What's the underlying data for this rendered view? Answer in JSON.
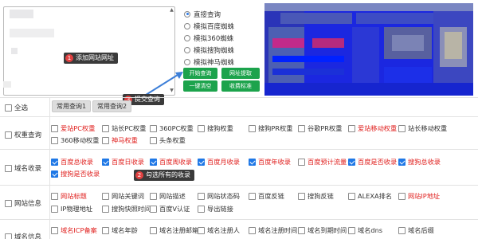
{
  "form": {
    "url_textarea_placeholder": "",
    "query_modes": [
      {
        "label": "直接查询",
        "selected": true
      },
      {
        "label": "模拟百度蜘蛛",
        "selected": false
      },
      {
        "label": "模拟360蜘蛛",
        "selected": false
      },
      {
        "label": "模拟搜狗蜘蛛",
        "selected": false
      },
      {
        "label": "模拟神马蜘蛛",
        "selected": false
      }
    ],
    "buttons": {
      "start_query": "开始查询",
      "extract_urls": "网址提取",
      "clear_all": "一键清空",
      "bookmark": "收费标准"
    }
  },
  "callouts": {
    "add_url": {
      "num": "1",
      "text": "添加网站网址"
    },
    "all_collect": {
      "num": "2",
      "text": "勾选所有的收录"
    },
    "submit": {
      "num": "3",
      "text": "提交查询"
    }
  },
  "colors": {
    "green": "#1ca34c",
    "red_text": "#e0211f",
    "checkbox_blue": "#1f78e6",
    "callout_bg": "#3a3a3a",
    "callout_badge": "#e14141",
    "arrow": "#3d7fd8"
  },
  "select_all": {
    "label": "全选",
    "presets": [
      "常用查询1",
      "常用查询2"
    ]
  },
  "sections": [
    {
      "label": "权重查询",
      "options": [
        {
          "label": "爱站PC权重",
          "checked": false,
          "red": true
        },
        {
          "label": "站长PC权重",
          "checked": false,
          "red": false
        },
        {
          "label": "360PC权重",
          "checked": false,
          "red": false
        },
        {
          "label": "搜狗权重",
          "checked": false,
          "red": false
        },
        {
          "label": "搜狗PR权重",
          "checked": false,
          "red": false
        },
        {
          "label": "谷歌PR权重",
          "checked": false,
          "red": false
        },
        {
          "label": "爱站移动权重",
          "checked": false,
          "red": true
        },
        {
          "label": "站长移动权重",
          "checked": false,
          "red": false
        },
        {
          "label": "360移动权重",
          "checked": false,
          "red": false
        },
        {
          "label": "神马权重",
          "checked": false,
          "red": true
        },
        {
          "label": "头条权重",
          "checked": false,
          "red": false
        }
      ]
    },
    {
      "label": "域名收录",
      "options": [
        {
          "label": "百度总收录",
          "checked": true,
          "red": true
        },
        {
          "label": "百度日收录",
          "checked": true,
          "red": true
        },
        {
          "label": "百度周收录",
          "checked": true,
          "red": true
        },
        {
          "label": "百度月收录",
          "checked": true,
          "red": true
        },
        {
          "label": "百度年收录",
          "checked": true,
          "red": true
        },
        {
          "label": "百度预计流量",
          "checked": false,
          "red": true
        },
        {
          "label": "百度是否收录",
          "checked": true,
          "red": true
        },
        {
          "label": "搜狗总收录",
          "checked": true,
          "red": true
        },
        {
          "label": "搜狗是否收录",
          "checked": true,
          "red": true
        }
      ]
    },
    {
      "label": "网站信息",
      "options": [
        {
          "label": "网站标题",
          "checked": false,
          "red": true
        },
        {
          "label": "网站关键词",
          "checked": false,
          "red": false
        },
        {
          "label": "网站描述",
          "checked": false,
          "red": false
        },
        {
          "label": "网站状态码",
          "checked": false,
          "red": false
        },
        {
          "label": "百度反链",
          "checked": false,
          "red": false
        },
        {
          "label": "搜狗反链",
          "checked": false,
          "red": false
        },
        {
          "label": "ALEXA排名",
          "checked": false,
          "red": false
        },
        {
          "label": "网站IP地址",
          "checked": false,
          "red": true
        },
        {
          "label": "IP物理地址",
          "checked": false,
          "red": false
        },
        {
          "label": "搜狗快照时间",
          "checked": false,
          "red": false
        },
        {
          "label": "百度V认证",
          "checked": false,
          "red": false
        },
        {
          "label": "导出链接",
          "checked": false,
          "red": false
        }
      ]
    },
    {
      "label": "域名信息",
      "options": [
        {
          "label": "域名ICP备案",
          "checked": false,
          "red": true
        },
        {
          "label": "域名年龄",
          "checked": false,
          "red": false
        },
        {
          "label": "域名注册邮箱",
          "checked": false,
          "red": false
        },
        {
          "label": "域名注册人",
          "checked": false,
          "red": false
        },
        {
          "label": "域名注册时间",
          "checked": false,
          "red": false
        },
        {
          "label": "域名到期时间",
          "checked": false,
          "red": false
        },
        {
          "label": "域名dns",
          "checked": false,
          "red": false
        },
        {
          "label": "域名后缀",
          "checked": false,
          "red": false
        }
      ]
    }
  ]
}
